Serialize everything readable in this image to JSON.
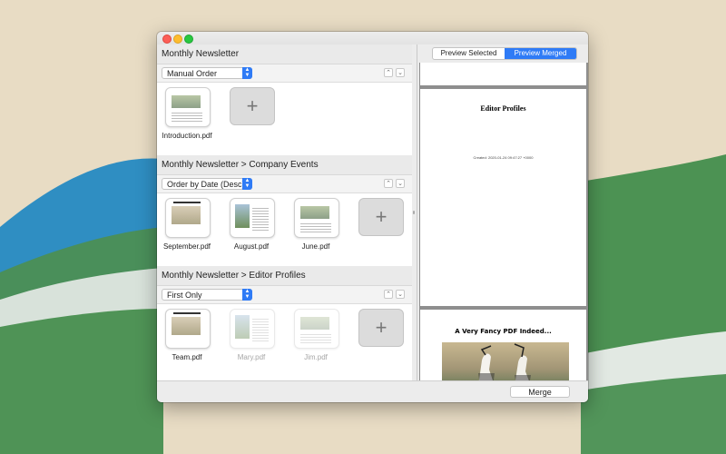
{
  "window": {
    "traffic_lights": [
      "close",
      "minimize",
      "zoom"
    ]
  },
  "sections": [
    {
      "title": "Monthly Newsletter",
      "order": "Manual Order",
      "files": [
        {
          "name": "Introduction.pdf",
          "dimmed": false
        }
      ]
    },
    {
      "title": "Monthly Newsletter > Company Events",
      "order": "Order by Date (Desc)",
      "files": [
        {
          "name": "September.pdf",
          "dimmed": false
        },
        {
          "name": "August.pdf",
          "dimmed": false
        },
        {
          "name": "June.pdf",
          "dimmed": false
        }
      ]
    },
    {
      "title": "Monthly Newsletter > Editor Profiles",
      "order": "First Only",
      "files": [
        {
          "name": "Team.pdf",
          "dimmed": false
        },
        {
          "name": "Mary.pdf",
          "dimmed": true
        },
        {
          "name": "Jim.pdf",
          "dimmed": true
        }
      ]
    }
  ],
  "controls": {
    "up_arrow": "⌃",
    "down_arrow": "⌄",
    "add": "+"
  },
  "preview": {
    "segments": [
      "Preview Selected",
      "Preview Merged"
    ],
    "active_segment": "Preview Merged",
    "page_title": "Editor Profiles",
    "page_created": "Created: 2020-01-24 09:47:27 +0000",
    "next_page_heading": "A Very Fancy PDF Indeed..."
  },
  "footer": {
    "merge_label": "Merge"
  },
  "colors": {
    "accent": "#2f7bf6",
    "window_bg": "#ececec"
  }
}
